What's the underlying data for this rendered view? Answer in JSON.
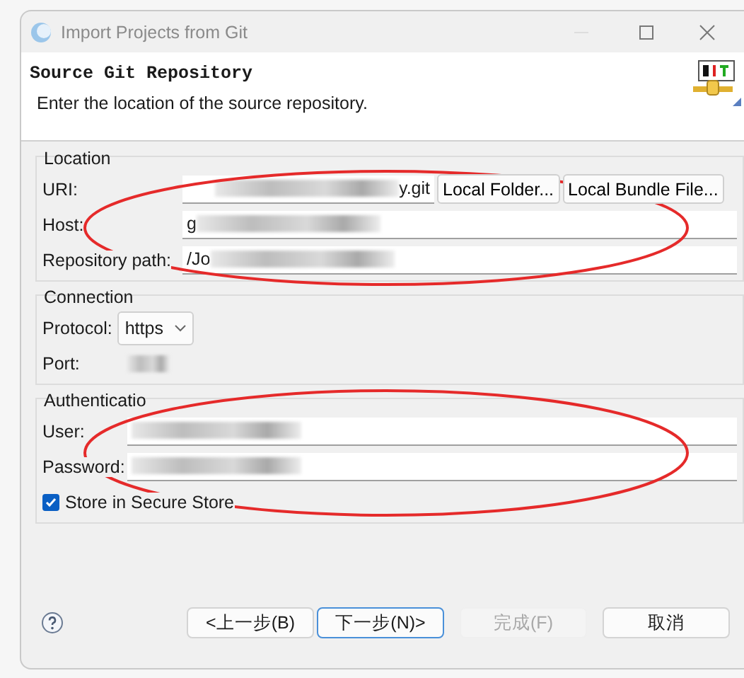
{
  "window": {
    "title": "Import Projects from Git"
  },
  "header": {
    "title": "Source Git Repository",
    "description": "Enter the location of the source repository."
  },
  "groups": [
    {
      "title": "Location",
      "circled": true,
      "rows": [
        {
          "kind": "field",
          "label": "URI:",
          "value": "y.git",
          "blur_before": true,
          "buttons": [
            "Local Folder...",
            "Local Bundle File..."
          ]
        },
        {
          "kind": "field",
          "label": "Host:",
          "value": "g",
          "blur_after": true
        },
        {
          "kind": "field",
          "label": "Repository path:",
          "value": "/Jo",
          "blur_after": true
        }
      ]
    },
    {
      "title": "Connection",
      "rows": [
        {
          "kind": "combo",
          "label": "Protocol:",
          "value": "https"
        },
        {
          "kind": "blank",
          "label": "Port:",
          "blur_after": true
        }
      ]
    },
    {
      "title": "Authenticatio",
      "circled": true,
      "rows": [
        {
          "kind": "field",
          "label": "User:",
          "blur_after": true
        },
        {
          "kind": "field",
          "label": "Password:",
          "blur_after": true
        },
        {
          "kind": "checkbox",
          "label": "Store in Secure Store",
          "checked": true
        }
      ]
    }
  ],
  "buttons": [
    {
      "label": "<上一步(B)",
      "disabled": false,
      "default": false
    },
    {
      "label": "下一步(N)>",
      "disabled": false,
      "default": true
    },
    {
      "label": "完成(F)",
      "disabled": true,
      "default": false
    },
    {
      "label": "取消",
      "disabled": false,
      "default": false
    }
  ]
}
